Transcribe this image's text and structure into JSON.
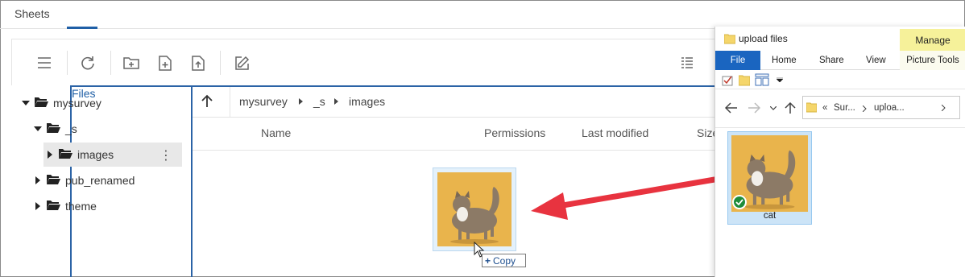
{
  "tabs": [
    {
      "label": "Sheets",
      "active": false
    },
    {
      "label": "Files",
      "active": true
    }
  ],
  "toolbar": {
    "buttons": [
      "menu-icon",
      "refresh-icon",
      "new-folder-icon",
      "new-file-icon",
      "upload-icon",
      "edit-icon",
      "details-view-icon"
    ]
  },
  "tree": {
    "items": [
      {
        "label": "mysurvey",
        "expanded": true,
        "level": 0
      },
      {
        "label": "_s",
        "expanded": true,
        "level": 1
      },
      {
        "label": "images",
        "expanded": false,
        "level": 2,
        "selected": true
      },
      {
        "label": "pub_renamed",
        "expanded": false,
        "level": 1
      },
      {
        "label": "theme",
        "expanded": false,
        "level": 1
      }
    ]
  },
  "breadcrumb": {
    "items": [
      "mysurvey",
      "_s",
      "images"
    ]
  },
  "columns": {
    "name": "Name",
    "permissions": "Permissions",
    "last_modified": "Last modified",
    "size": "Size"
  },
  "drag": {
    "copy_label": "Copy",
    "copy_symbol": "+"
  },
  "explorer": {
    "title": "upload files",
    "manage": "Manage",
    "ribbon_tabs": [
      "File",
      "Home",
      "Share",
      "View",
      "Picture Tools"
    ],
    "address": {
      "prefix": "«",
      "part1": "Sur...",
      "part2": "uploa..."
    },
    "file": {
      "name": "cat"
    }
  },
  "colors": {
    "accent": "#1f5fa6",
    "arrow": "#e8333f",
    "manage_bg": "#f6f19a",
    "file_tab": "#1a65c0"
  }
}
